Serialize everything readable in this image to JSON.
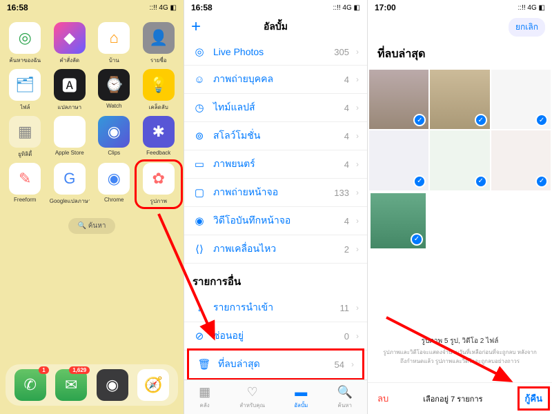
{
  "pane1": {
    "time": "16:58",
    "signal": "::!! 4G ◧",
    "apps": [
      {
        "label": "ค้นหาของฉัน",
        "bg": "#fff",
        "icon": "◎",
        "fg": "#2da44e"
      },
      {
        "label": "คำสั่งลัด",
        "bg": "linear-gradient(135deg,#ff4e9b,#6b5cff)",
        "icon": "◆",
        "fg": "#fff"
      },
      {
        "label": "บ้าน",
        "bg": "#fff",
        "icon": "⌂",
        "fg": "#ff9500"
      },
      {
        "label": "รายชื่อ",
        "bg": "#8e8e93",
        "icon": "👤",
        "fg": "#fff"
      },
      {
        "label": "ไฟล์",
        "bg": "#fff",
        "icon": "🗂",
        "fg": "#3498db"
      },
      {
        "label": "แปลภาษา",
        "bg": "#1c1c1e",
        "icon": "🅰",
        "fg": "#fff"
      },
      {
        "label": "Watch",
        "bg": "#1c1c1e",
        "icon": "⌚",
        "fg": "#fff"
      },
      {
        "label": "เคล็ดลับ",
        "bg": "#ffcc00",
        "icon": "💡",
        "fg": "#fff"
      },
      {
        "label": "ยูทิลิตี้",
        "bg": "rgba(255,255,255,0.4)",
        "icon": "▦",
        "fg": "#888"
      },
      {
        "label": "Apple Store",
        "bg": "#fff",
        "icon": "",
        "fg": "#3498db"
      },
      {
        "label": "Clips",
        "bg": "linear-gradient(135deg,#3498db,#5856d6)",
        "icon": "◉",
        "fg": "#fff"
      },
      {
        "label": "Feedback",
        "bg": "#5856d6",
        "icon": "✱",
        "fg": "#fff"
      },
      {
        "label": "Freeform",
        "bg": "#fff",
        "icon": "✎",
        "fg": "#ff6b6b"
      },
      {
        "label": "Googleแปลภาษา",
        "bg": "#fff",
        "icon": "G",
        "fg": "#4285f4"
      },
      {
        "label": "Chrome",
        "bg": "#fff",
        "icon": "◉",
        "fg": "#4285f4"
      },
      {
        "label": "รูปภาพ",
        "bg": "#fff",
        "icon": "✿",
        "fg": "#ff6b6b",
        "hl": true
      }
    ],
    "search": "🔍 ค้นหา",
    "dock": [
      {
        "bg": "linear-gradient(#65c466,#2da44e)",
        "icon": "✆",
        "badge": "1"
      },
      {
        "bg": "linear-gradient(#65c466,#2da44e)",
        "icon": "✉",
        "badge": "1,629"
      },
      {
        "bg": "#3a3a3c",
        "icon": "◉",
        "badge": ""
      },
      {
        "bg": "#fff",
        "icon": "🧭",
        "badge": ""
      }
    ]
  },
  "pane2": {
    "time": "16:58",
    "signal": "::!! 4G ◧",
    "title": "อัลบั้ม",
    "rows": [
      {
        "icon": "◎",
        "label": "Live Photos",
        "count": "305"
      },
      {
        "icon": "☺",
        "label": "ภาพถ่ายบุคคล",
        "count": "4"
      },
      {
        "icon": "◷",
        "label": "ไทม์แลปส์",
        "count": "4"
      },
      {
        "icon": "⊚",
        "label": "สโลว์โมชั่น",
        "count": "4"
      },
      {
        "icon": "▭",
        "label": "ภาพยนตร์",
        "count": "4"
      },
      {
        "icon": "▢",
        "label": "ภาพถ่ายหน้าจอ",
        "count": "133"
      },
      {
        "icon": "◉",
        "label": "วิดีโอบันทึกหน้าจอ",
        "count": "4"
      },
      {
        "icon": "⟨⟩",
        "label": "ภาพเคลื่อนไหว",
        "count": "2"
      }
    ],
    "section": "รายการอื่น",
    "rows2": [
      {
        "icon": "↓",
        "label": "รายการนำเข้า",
        "count": "11"
      },
      {
        "icon": "⊘",
        "label": "ซ่อนอยู่",
        "count": "0"
      },
      {
        "icon": "🗑",
        "label": "ที่ลบล่าสุด",
        "count": "54",
        "hl": true
      }
    ],
    "tabs": [
      {
        "icon": "▦",
        "label": "คลัง"
      },
      {
        "icon": "♡",
        "label": "สำหรับคุณ"
      },
      {
        "icon": "▬",
        "label": "อัลบั้ม",
        "active": true
      },
      {
        "icon": "🔍",
        "label": "ค้นหา"
      }
    ]
  },
  "pane3": {
    "time": "17:00",
    "signal": "::!! 4G ◧",
    "cancel": "ยกเลิก",
    "title": "ที่ลบล่าสุด",
    "info": "รูปภาพ 5 รูป, วิดีโอ 2 ไฟล์",
    "infosub": "รูปภาพและวิดีโอจะแสดงจำนวนวันที่เหลือก่อนที่จะถูกลบ หลังจากถึงกำหนดแล้ว รูปภาพและวิดีโอจะถูกลบอย่างถาวร",
    "delete": "ลบ",
    "selected": "เลือกอยู่ 7 รายการ",
    "recover": "กู้คืน"
  }
}
